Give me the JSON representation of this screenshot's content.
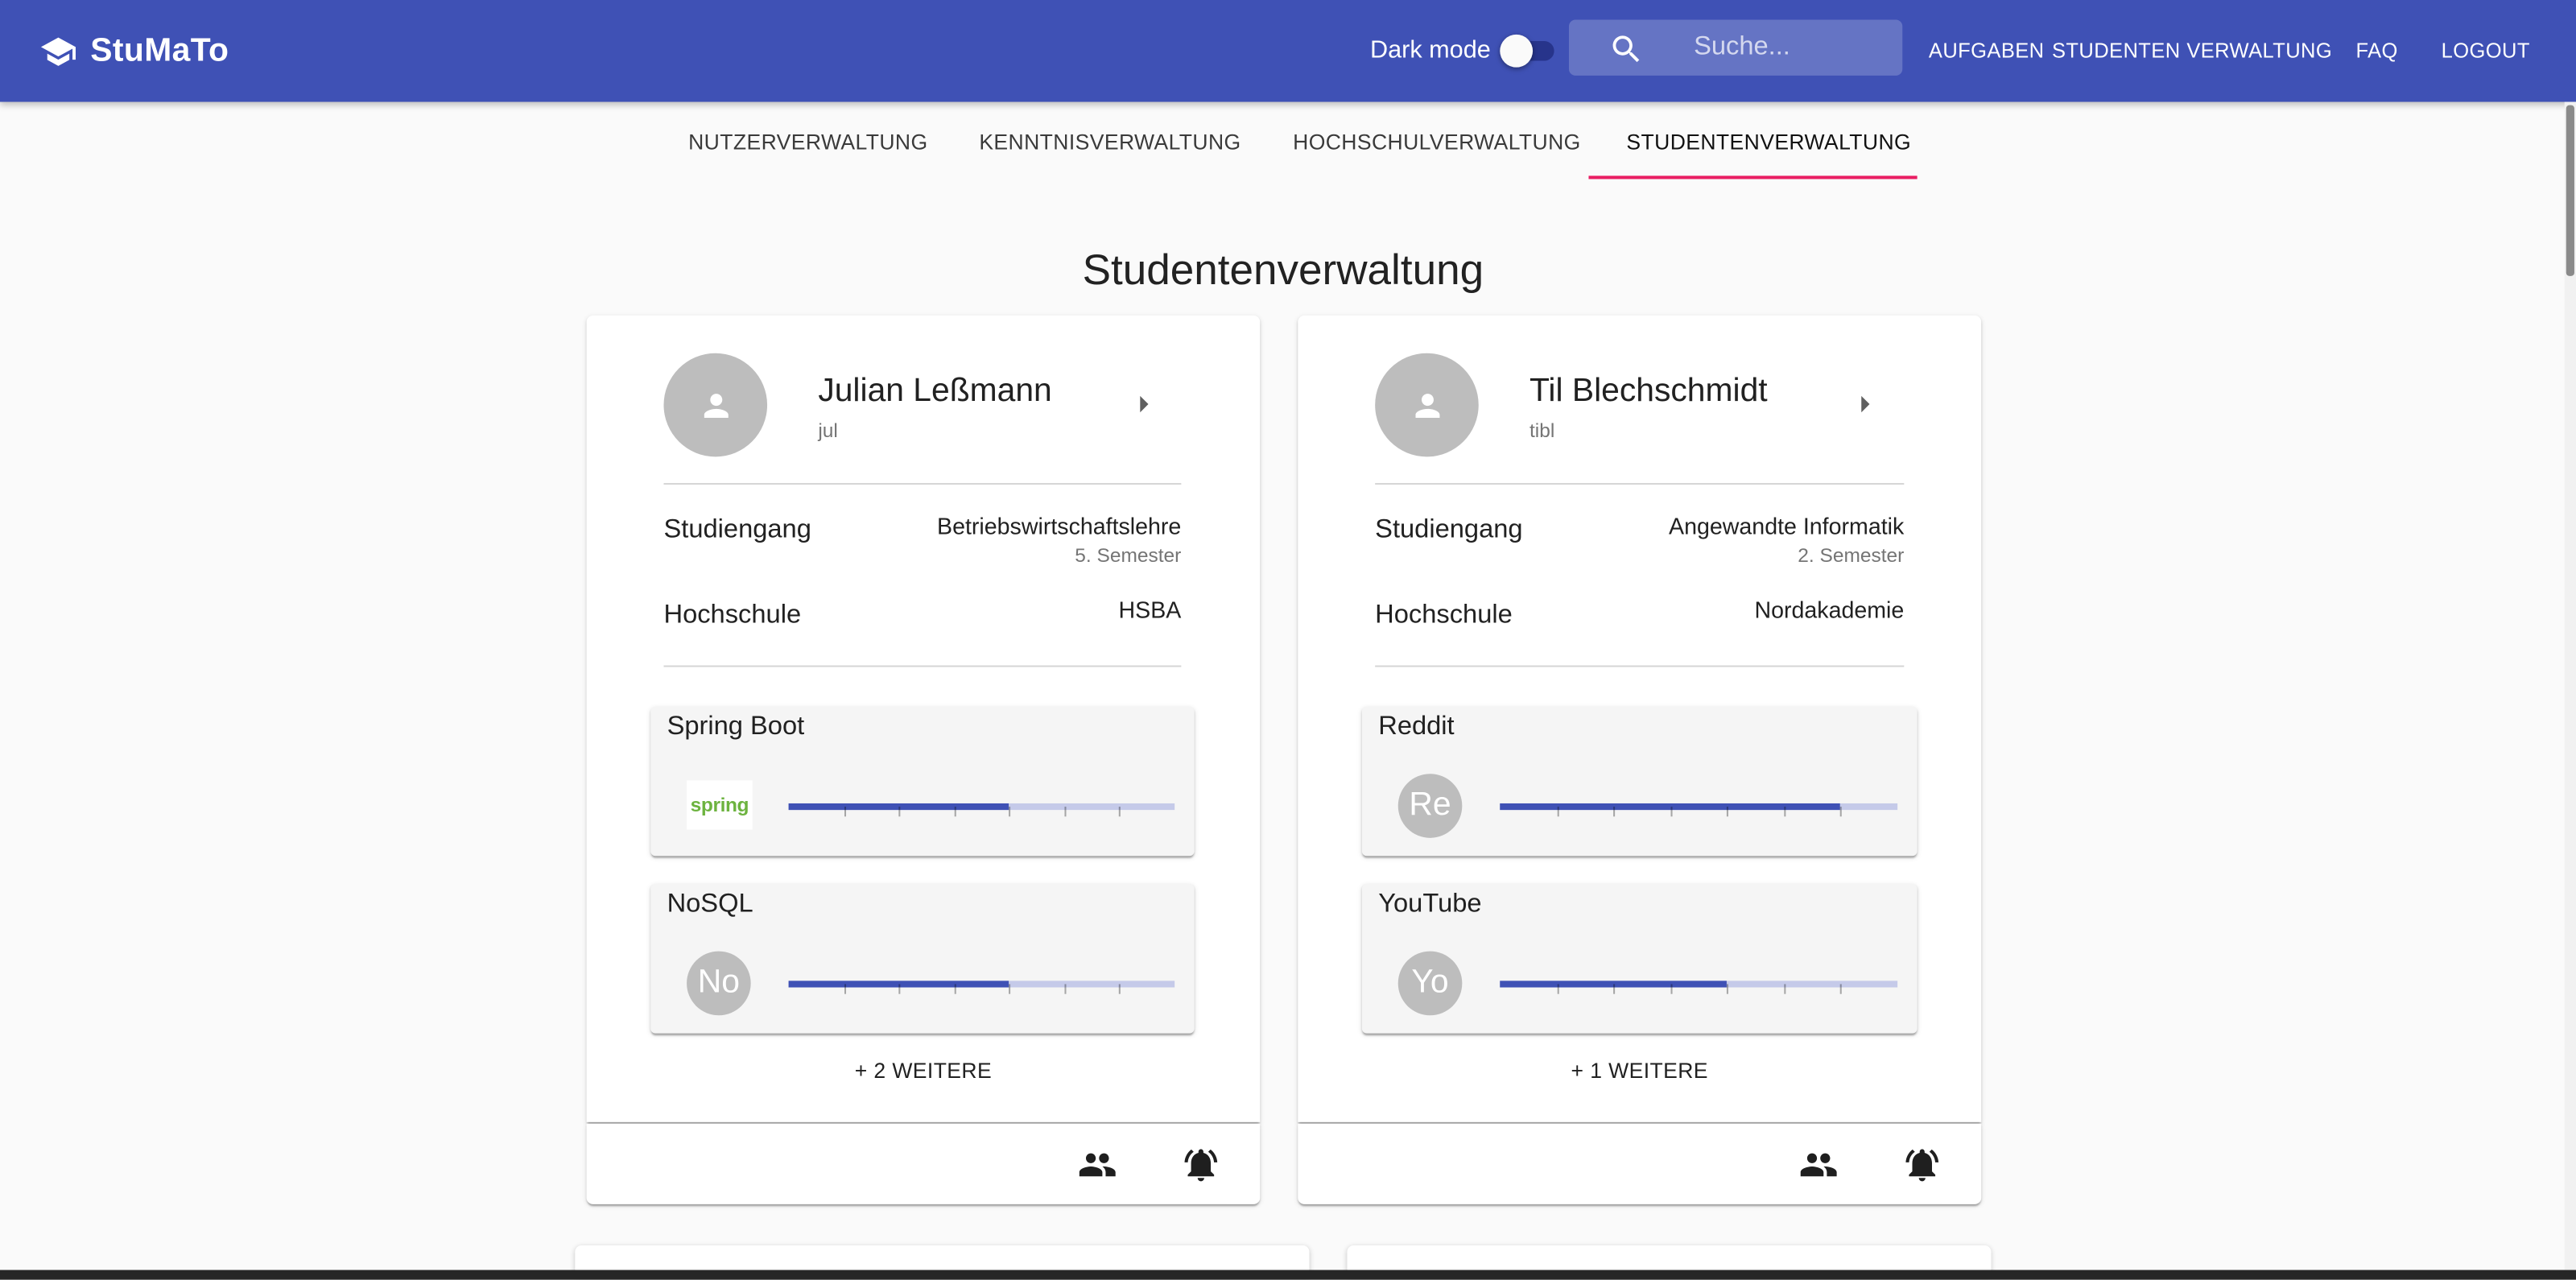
{
  "header": {
    "app_title": "StuMaTo",
    "logo_icon": "graduation-cap-icon",
    "dark_mode_label": "Dark mode",
    "dark_mode_on": false,
    "search_placeholder": "Suche...",
    "search_icon": "search-icon",
    "nav": [
      "AUFGABEN",
      "STUDENTEN",
      "VERWALTUNG",
      "FAQ",
      "LOGOUT"
    ]
  },
  "tabs": {
    "items": [
      "NUTZERVERWALTUNG",
      "KENNTNISVERWALTUNG",
      "HOCHSCHULVERWALTUNG",
      "STUDENTENVERWALTUNG"
    ],
    "active_index": 3
  },
  "page_title": "Studentenverwaltung",
  "students": [
    {
      "name": "Julian Leßmann",
      "username": "jul",
      "study_label": "Studiengang",
      "study_program": "Betriebswirtschaftslehre",
      "semester": "5. Semester",
      "university_label": "Hochschule",
      "university": "HSBA",
      "skills": [
        {
          "name": "Spring Boot",
          "icon": "spring-logo",
          "logo_text": "spring",
          "level": 4,
          "max_level": 7
        },
        {
          "name": "NoSQL",
          "initials": "No",
          "level": 4,
          "max_level": 7
        }
      ],
      "more_label": "+ 2 WEITERE"
    },
    {
      "name": "Til Blechschmidt",
      "username": "tibl",
      "study_label": "Studiengang",
      "study_program": "Angewandte Informatik",
      "semester": "2. Semester",
      "university_label": "Hochschule",
      "university": "Nordakademie",
      "skills": [
        {
          "name": "Reddit",
          "initials": "Re",
          "level": 6,
          "max_level": 7
        },
        {
          "name": "YouTube",
          "initials": "Yo",
          "level": 4,
          "max_level": 7
        }
      ],
      "more_label": "+ 1 WEITERE"
    }
  ],
  "card_actions": [
    "people-icon",
    "notifications-active-icon"
  ],
  "colors": {
    "primary": "#3f51b5",
    "accent": "#e91e63",
    "slider_track": "#c5cae9",
    "background": "#fafafa",
    "avatar": "#bdbdbd"
  }
}
